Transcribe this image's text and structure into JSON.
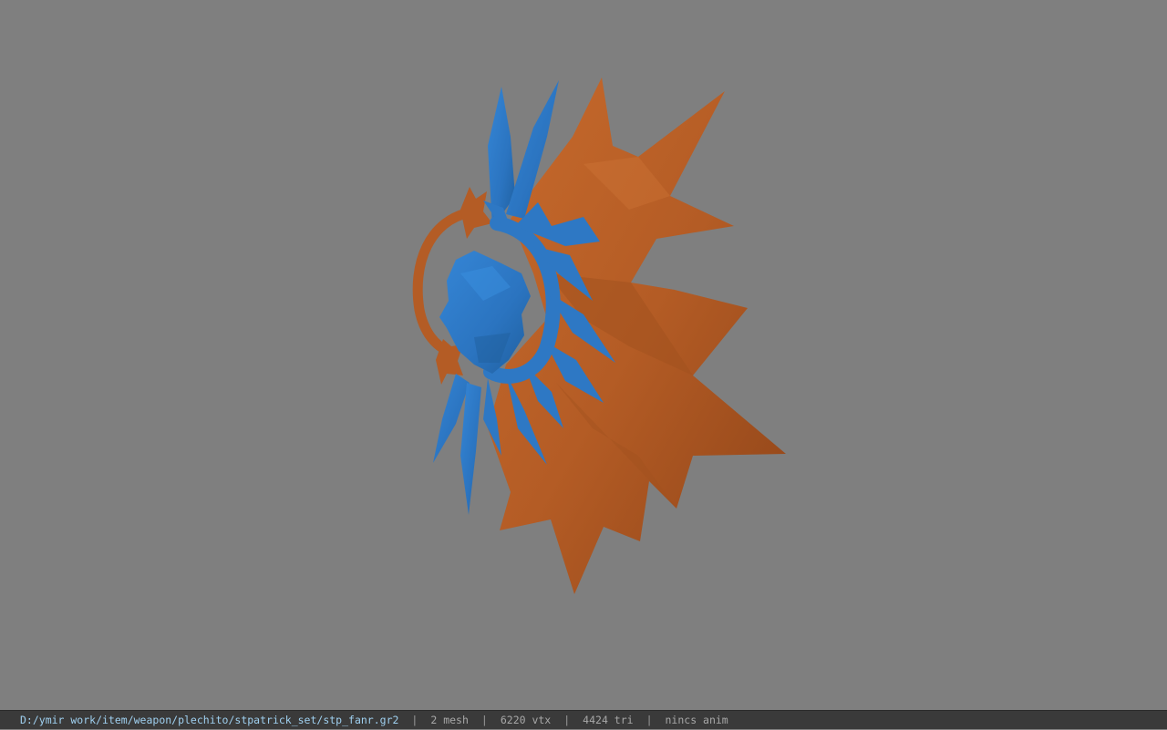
{
  "viewport": {
    "background_color": "#7f7f7f",
    "model": {
      "meshes": [
        {
          "name": "orange-mesh",
          "color": "#b85f27"
        },
        {
          "name": "blue-mesh",
          "color": "#2e78c4"
        }
      ]
    }
  },
  "status_bar": {
    "file_path": "D:/ymir work/item/weapon/plechito/stpatrick_set/stp_fanr.gr2",
    "mesh_count": "2 mesh",
    "vertex_count": "6220 vtx",
    "triangle_count": "4424 tri",
    "anim_status": "nincs anim",
    "separator": "|"
  }
}
